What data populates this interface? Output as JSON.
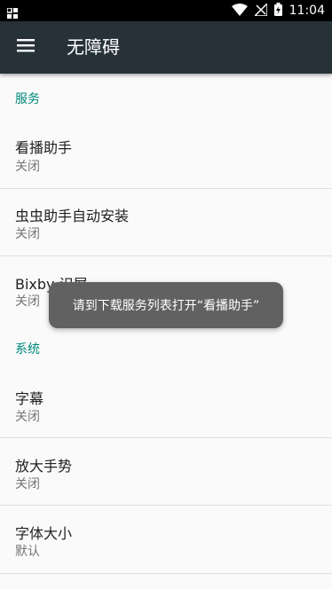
{
  "status_bar": {
    "time": "11:04",
    "icons": [
      "app-grid-icon",
      "wifi-icon",
      "signal-off-icon",
      "battery-charging-icon"
    ]
  },
  "app_bar": {
    "title": "无障碍",
    "menu_icon": "hamburger-menu-icon"
  },
  "sections": [
    {
      "header": "服务",
      "items": [
        {
          "title": "看播助手",
          "summary": "关闭"
        },
        {
          "title": "虫虫助手自动安装",
          "summary": "关闭"
        },
        {
          "title": "Bixby 识屏",
          "summary": "关闭"
        }
      ]
    },
    {
      "header": "系统",
      "items": [
        {
          "title": "字幕",
          "summary": "关闭"
        },
        {
          "title": "放大手势",
          "summary": "关闭"
        },
        {
          "title": "字体大小",
          "summary": "默认"
        }
      ]
    }
  ],
  "toast": {
    "text": "请到下载服务列表打开“看播助手”"
  }
}
